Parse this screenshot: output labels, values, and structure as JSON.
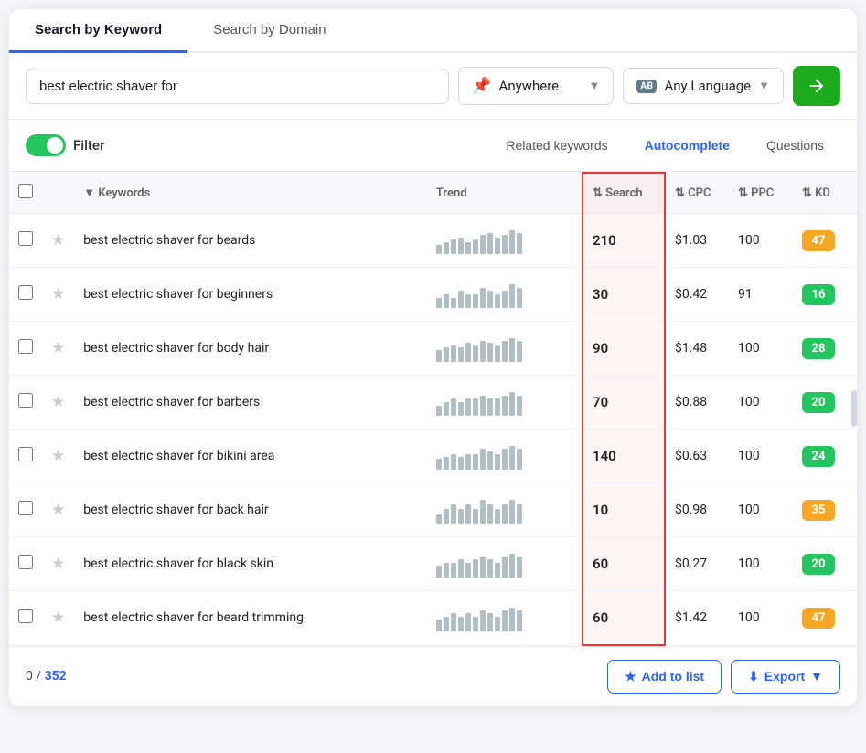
{
  "tabs": [
    {
      "label": "Search by Keyword",
      "active": true
    },
    {
      "label": "Search by Domain",
      "active": false
    }
  ],
  "searchBar": {
    "keyword": "best electric shaver for",
    "location": "Anywhere",
    "language": "Any Language",
    "langIcon": "AB",
    "searchBtnLabel": "Search"
  },
  "filter": {
    "label": "Filter",
    "enabled": true
  },
  "keywordTabs": [
    {
      "label": "Related keywords",
      "active": false
    },
    {
      "label": "Autocomplete",
      "active": true
    },
    {
      "label": "Questions",
      "active": false
    }
  ],
  "table": {
    "columns": [
      {
        "key": "check",
        "label": ""
      },
      {
        "key": "star",
        "label": ""
      },
      {
        "key": "keyword",
        "label": "Keywords",
        "sortable": true
      },
      {
        "key": "trend",
        "label": "Trend"
      },
      {
        "key": "search",
        "label": "Search",
        "sortable": true
      },
      {
        "key": "cpc",
        "label": "CPC",
        "sortable": true
      },
      {
        "key": "ppc",
        "label": "PPC",
        "sortable": true
      },
      {
        "key": "kd",
        "label": "KD",
        "sortable": true
      }
    ],
    "rows": [
      {
        "keyword": "best electric shaver for beards",
        "trend": [
          4,
          5,
          6,
          7,
          5,
          6,
          8,
          9,
          7,
          8,
          10,
          9
        ],
        "search": "210",
        "cpc": "$1.03",
        "ppc": "100",
        "kd": 47,
        "kdColor": "#f5a623"
      },
      {
        "keyword": "best electric shaver for beginners",
        "trend": [
          3,
          4,
          3,
          5,
          4,
          4,
          6,
          5,
          4,
          5,
          7,
          6
        ],
        "search": "30",
        "cpc": "$0.42",
        "ppc": "91",
        "kd": 16,
        "kdColor": "#22c55e"
      },
      {
        "keyword": "best electric shaver for body hair",
        "trend": [
          5,
          6,
          7,
          6,
          8,
          7,
          9,
          8,
          7,
          9,
          10,
          9
        ],
        "search": "90",
        "cpc": "$1.48",
        "ppc": "100",
        "kd": 28,
        "kdColor": "#22c55e"
      },
      {
        "keyword": "best electric shaver for barbers",
        "trend": [
          3,
          4,
          5,
          4,
          5,
          5,
          6,
          5,
          5,
          6,
          7,
          6
        ],
        "search": "70",
        "cpc": "$0.88",
        "ppc": "100",
        "kd": 20,
        "kdColor": "#22c55e"
      },
      {
        "keyword": "best electric shaver for bikini area",
        "trend": [
          4,
          5,
          6,
          5,
          6,
          6,
          8,
          7,
          6,
          8,
          9,
          8
        ],
        "search": "140",
        "cpc": "$0.63",
        "ppc": "100",
        "kd": 24,
        "kdColor": "#22c55e"
      },
      {
        "keyword": "best electric shaver for back hair",
        "trend": [
          2,
          3,
          4,
          3,
          4,
          3,
          5,
          4,
          3,
          4,
          5,
          4
        ],
        "search": "10",
        "cpc": "$0.98",
        "ppc": "100",
        "kd": 35,
        "kdColor": "#f5a623"
      },
      {
        "keyword": "best electric shaver for black skin",
        "trend": [
          4,
          5,
          5,
          6,
          5,
          6,
          7,
          6,
          5,
          7,
          8,
          7
        ],
        "search": "60",
        "cpc": "$0.27",
        "ppc": "100",
        "kd": 20,
        "kdColor": "#22c55e"
      },
      {
        "keyword": "best electric shaver for beard trimming",
        "trend": [
          4,
          5,
          6,
          5,
          6,
          5,
          7,
          6,
          5,
          7,
          8,
          7
        ],
        "search": "60",
        "cpc": "$1.42",
        "ppc": "100",
        "kd": 47,
        "kdColor": "#f5a623"
      }
    ]
  },
  "footer": {
    "selected": "0",
    "total": "352",
    "addToList": "Add to list",
    "export": "Export"
  }
}
